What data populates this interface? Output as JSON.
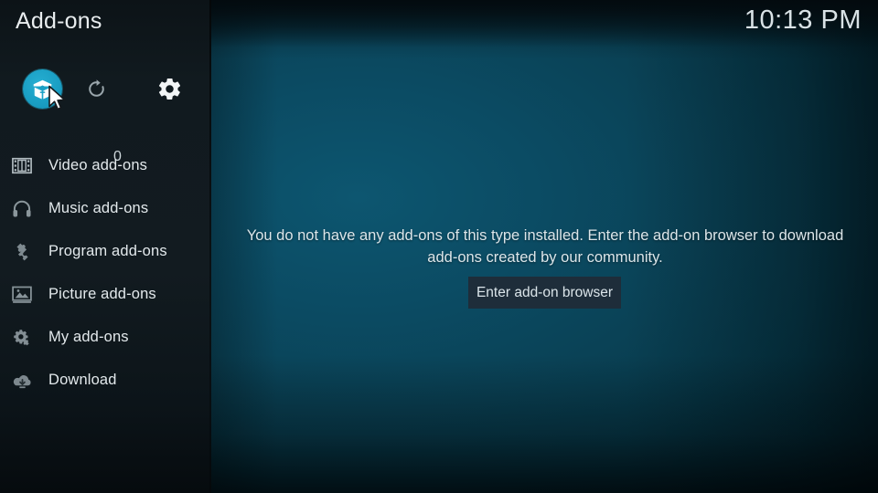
{
  "header": {
    "title": "Add-ons",
    "clock": "10:13 PM"
  },
  "toolbar": {
    "addons_icon": "package-box-icon",
    "addons_label": "Add-on browser",
    "refresh_icon": "refresh-icon",
    "refresh_count": "0",
    "settings_icon": "gear-icon"
  },
  "sidebar": {
    "items": [
      {
        "label": "Video add-ons",
        "icon": "film-strip-icon",
        "name": "video-add-ons"
      },
      {
        "label": "Music add-ons",
        "icon": "headphones-icon",
        "name": "music-add-ons"
      },
      {
        "label": "Program add-ons",
        "icon": "puzzle-pieces-icon",
        "name": "program-add-ons"
      },
      {
        "label": "Picture add-ons",
        "icon": "picture-frame-icon",
        "name": "picture-add-ons"
      },
      {
        "label": "My add-ons",
        "icon": "gear-puzzle-icon",
        "name": "my-add-ons"
      },
      {
        "label": "Download",
        "icon": "download-cloud-icon",
        "name": "download"
      }
    ]
  },
  "main": {
    "empty_message": "You do not have any add-ons of this type installed. Enter the add-on browser to download add-ons created by our community.",
    "browse_button": "Enter add-on browser"
  },
  "colors": {
    "accent": "#1a9fc4",
    "sidebar_bg": "#111a1f",
    "main_bg": "#0a4256",
    "button_bg": "#1e2d3a",
    "text": "#e3e9ec"
  }
}
